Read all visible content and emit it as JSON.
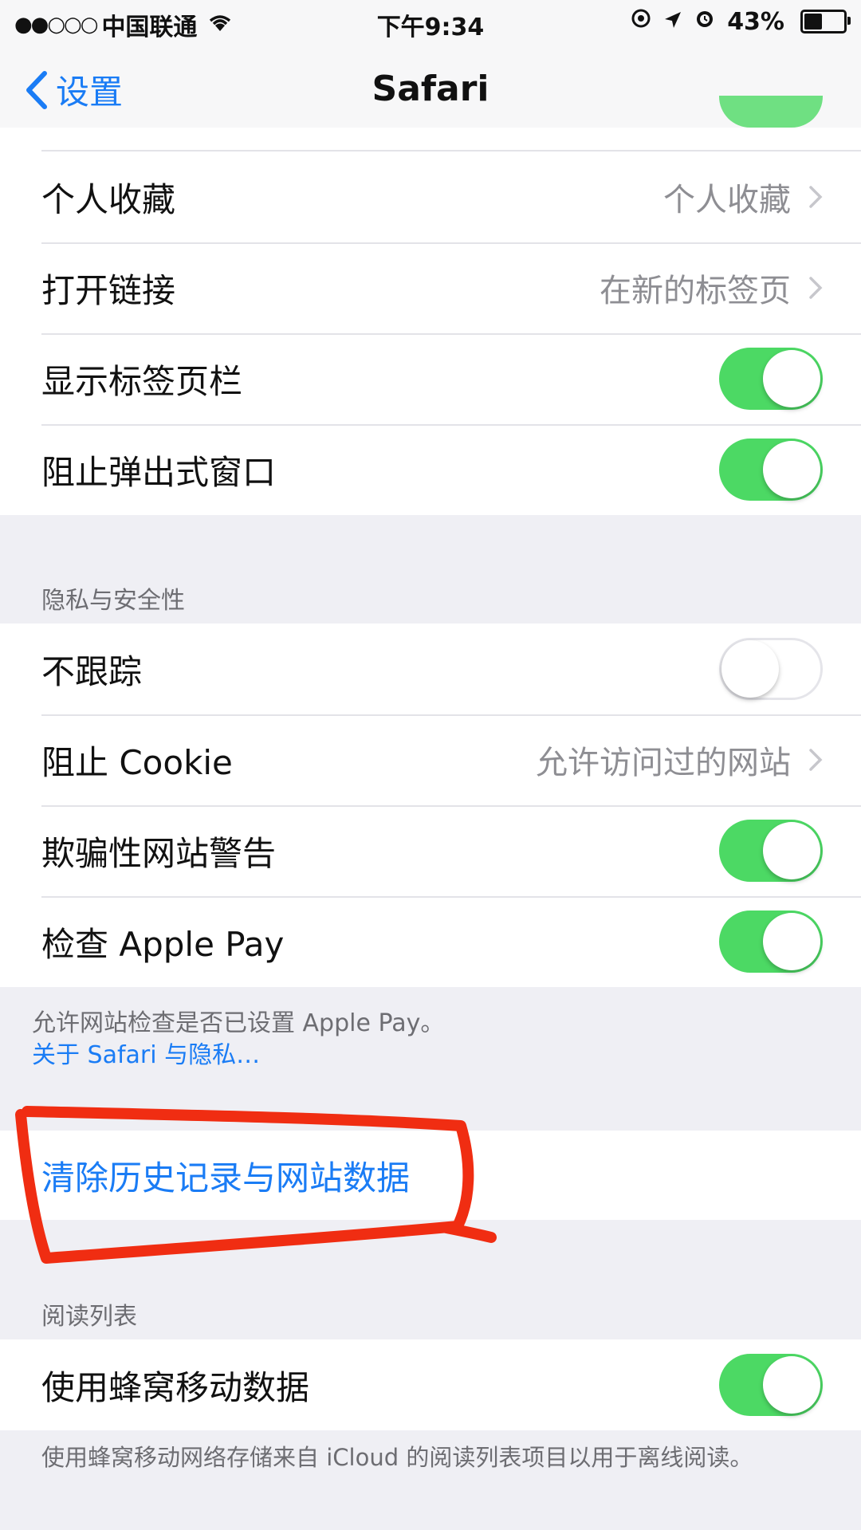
{
  "status_bar": {
    "signal": "●●○○○",
    "carrier": "中国联通",
    "time": "下午9:34",
    "battery": "43%",
    "battery_level": 0.43
  },
  "nav": {
    "back_label": "设置",
    "title": "Safari"
  },
  "general": [
    {
      "label": "个人收藏",
      "value": "个人收藏",
      "type": "link"
    },
    {
      "label": "打开链接",
      "value": "在新的标签页",
      "type": "link"
    },
    {
      "label": "显示标签页栏",
      "type": "toggle",
      "on": true
    },
    {
      "label": "阻止弹出式窗口",
      "type": "toggle",
      "on": true
    }
  ],
  "privacy": {
    "header": "隐私与安全性",
    "rows": [
      {
        "label": "不跟踪",
        "type": "toggle",
        "on": false
      },
      {
        "label": "阻止 Cookie",
        "value": "允许访问过的网站",
        "type": "link"
      },
      {
        "label": "欺骗性网站警告",
        "type": "toggle",
        "on": true
      },
      {
        "label": "检查 Apple Pay",
        "type": "toggle",
        "on": true
      }
    ],
    "footer": "允许网站检查是否已设置 Apple Pay。",
    "footer_link": "关于 Safari 与隐私…"
  },
  "clear": {
    "label": "清除历史记录与网站数据"
  },
  "reading_list": {
    "header": "阅读列表",
    "rows": [
      {
        "label": "使用蜂窝移动数据",
        "type": "toggle",
        "on": true
      }
    ],
    "footer": "使用蜂窝移动网络存储来自 iCloud 的阅读列表项目以用于离线阅读。"
  },
  "colors": {
    "accent": "#1a7cf5",
    "toggle_on": "#4cd964",
    "annotation": "#f02d12"
  }
}
